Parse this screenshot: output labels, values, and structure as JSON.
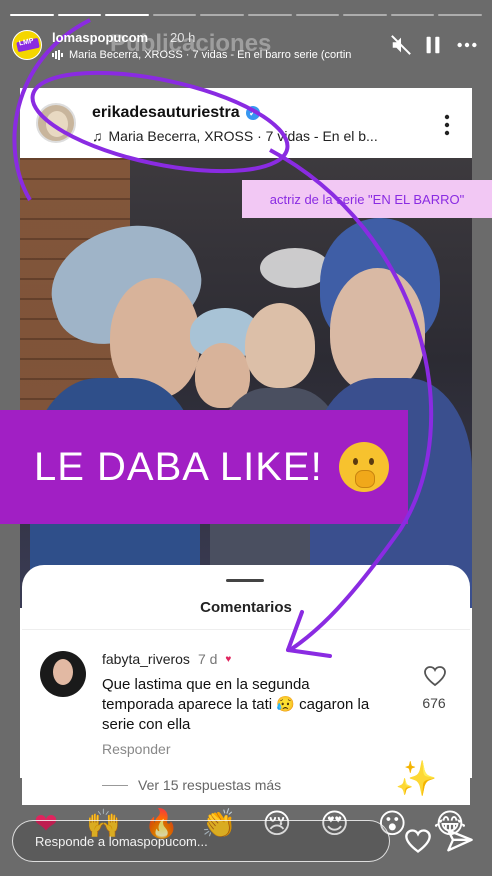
{
  "progress": {
    "total": 10,
    "current": 3
  },
  "header": {
    "username": "lomaspopucom",
    "time": "20 h",
    "music": "Maria Becerra, XROSS · 7 vidas - En el barro serie (cortin"
  },
  "ghost_title": "Publicaciones",
  "post": {
    "username": "erikadesauturiestra",
    "music": "Maria Becerra, XROSS · 7 vidas - En el b..."
  },
  "tag": "actriz de la serie \"EN EL BARRO\"",
  "banner": {
    "text": "LE DABA LIKE!",
    "emoji": "face-with-hand-over-mouth"
  },
  "comments": {
    "title": "Comentarios",
    "user": "fabyta_riveros",
    "age": "7 d",
    "text": "Que lastima que en la segunda temporada aparece la tati 😥 cagaron la serie con ella",
    "reply_label": "Responder",
    "likes": "676",
    "more_replies": "Ver 15 respuestas más"
  },
  "reactions": [
    "❤",
    "🙌",
    "🔥",
    "👏",
    "😢",
    "😍",
    "😮",
    "😂"
  ],
  "reply_placeholder": "Responde a lomaspopucom...",
  "colors": {
    "accent": "#a11fc4",
    "tag_bg": "#f2c8f4",
    "annotation": "#8a2be2"
  }
}
